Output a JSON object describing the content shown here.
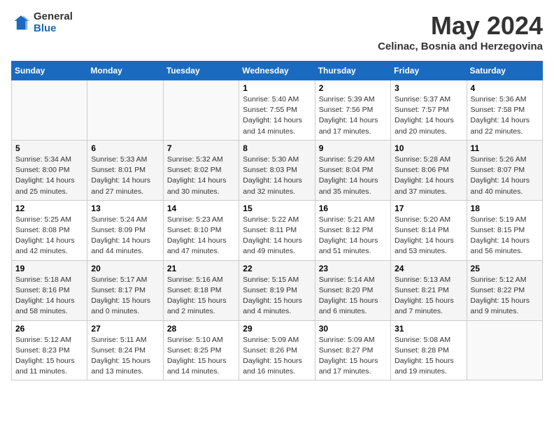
{
  "logo": {
    "general": "General",
    "blue": "Blue"
  },
  "title": "May 2024",
  "location": "Celinac, Bosnia and Herzegovina",
  "days_of_week": [
    "Sunday",
    "Monday",
    "Tuesday",
    "Wednesday",
    "Thursday",
    "Friday",
    "Saturday"
  ],
  "weeks": [
    [
      {
        "num": "",
        "info": ""
      },
      {
        "num": "",
        "info": ""
      },
      {
        "num": "",
        "info": ""
      },
      {
        "num": "1",
        "info": "Sunrise: 5:40 AM\nSunset: 7:55 PM\nDaylight: 14 hours\nand 14 minutes."
      },
      {
        "num": "2",
        "info": "Sunrise: 5:39 AM\nSunset: 7:56 PM\nDaylight: 14 hours\nand 17 minutes."
      },
      {
        "num": "3",
        "info": "Sunrise: 5:37 AM\nSunset: 7:57 PM\nDaylight: 14 hours\nand 20 minutes."
      },
      {
        "num": "4",
        "info": "Sunrise: 5:36 AM\nSunset: 7:58 PM\nDaylight: 14 hours\nand 22 minutes."
      }
    ],
    [
      {
        "num": "5",
        "info": "Sunrise: 5:34 AM\nSunset: 8:00 PM\nDaylight: 14 hours\nand 25 minutes."
      },
      {
        "num": "6",
        "info": "Sunrise: 5:33 AM\nSunset: 8:01 PM\nDaylight: 14 hours\nand 27 minutes."
      },
      {
        "num": "7",
        "info": "Sunrise: 5:32 AM\nSunset: 8:02 PM\nDaylight: 14 hours\nand 30 minutes."
      },
      {
        "num": "8",
        "info": "Sunrise: 5:30 AM\nSunset: 8:03 PM\nDaylight: 14 hours\nand 32 minutes."
      },
      {
        "num": "9",
        "info": "Sunrise: 5:29 AM\nSunset: 8:04 PM\nDaylight: 14 hours\nand 35 minutes."
      },
      {
        "num": "10",
        "info": "Sunrise: 5:28 AM\nSunset: 8:06 PM\nDaylight: 14 hours\nand 37 minutes."
      },
      {
        "num": "11",
        "info": "Sunrise: 5:26 AM\nSunset: 8:07 PM\nDaylight: 14 hours\nand 40 minutes."
      }
    ],
    [
      {
        "num": "12",
        "info": "Sunrise: 5:25 AM\nSunset: 8:08 PM\nDaylight: 14 hours\nand 42 minutes."
      },
      {
        "num": "13",
        "info": "Sunrise: 5:24 AM\nSunset: 8:09 PM\nDaylight: 14 hours\nand 44 minutes."
      },
      {
        "num": "14",
        "info": "Sunrise: 5:23 AM\nSunset: 8:10 PM\nDaylight: 14 hours\nand 47 minutes."
      },
      {
        "num": "15",
        "info": "Sunrise: 5:22 AM\nSunset: 8:11 PM\nDaylight: 14 hours\nand 49 minutes."
      },
      {
        "num": "16",
        "info": "Sunrise: 5:21 AM\nSunset: 8:12 PM\nDaylight: 14 hours\nand 51 minutes."
      },
      {
        "num": "17",
        "info": "Sunrise: 5:20 AM\nSunset: 8:14 PM\nDaylight: 14 hours\nand 53 minutes."
      },
      {
        "num": "18",
        "info": "Sunrise: 5:19 AM\nSunset: 8:15 PM\nDaylight: 14 hours\nand 56 minutes."
      }
    ],
    [
      {
        "num": "19",
        "info": "Sunrise: 5:18 AM\nSunset: 8:16 PM\nDaylight: 14 hours\nand 58 minutes."
      },
      {
        "num": "20",
        "info": "Sunrise: 5:17 AM\nSunset: 8:17 PM\nDaylight: 15 hours\nand 0 minutes."
      },
      {
        "num": "21",
        "info": "Sunrise: 5:16 AM\nSunset: 8:18 PM\nDaylight: 15 hours\nand 2 minutes."
      },
      {
        "num": "22",
        "info": "Sunrise: 5:15 AM\nSunset: 8:19 PM\nDaylight: 15 hours\nand 4 minutes."
      },
      {
        "num": "23",
        "info": "Sunrise: 5:14 AM\nSunset: 8:20 PM\nDaylight: 15 hours\nand 6 minutes."
      },
      {
        "num": "24",
        "info": "Sunrise: 5:13 AM\nSunset: 8:21 PM\nDaylight: 15 hours\nand 7 minutes."
      },
      {
        "num": "25",
        "info": "Sunrise: 5:12 AM\nSunset: 8:22 PM\nDaylight: 15 hours\nand 9 minutes."
      }
    ],
    [
      {
        "num": "26",
        "info": "Sunrise: 5:12 AM\nSunset: 8:23 PM\nDaylight: 15 hours\nand 11 minutes."
      },
      {
        "num": "27",
        "info": "Sunrise: 5:11 AM\nSunset: 8:24 PM\nDaylight: 15 hours\nand 13 minutes."
      },
      {
        "num": "28",
        "info": "Sunrise: 5:10 AM\nSunset: 8:25 PM\nDaylight: 15 hours\nand 14 minutes."
      },
      {
        "num": "29",
        "info": "Sunrise: 5:09 AM\nSunset: 8:26 PM\nDaylight: 15 hours\nand 16 minutes."
      },
      {
        "num": "30",
        "info": "Sunrise: 5:09 AM\nSunset: 8:27 PM\nDaylight: 15 hours\nand 17 minutes."
      },
      {
        "num": "31",
        "info": "Sunrise: 5:08 AM\nSunset: 8:28 PM\nDaylight: 15 hours\nand 19 minutes."
      },
      {
        "num": "",
        "info": ""
      }
    ]
  ]
}
